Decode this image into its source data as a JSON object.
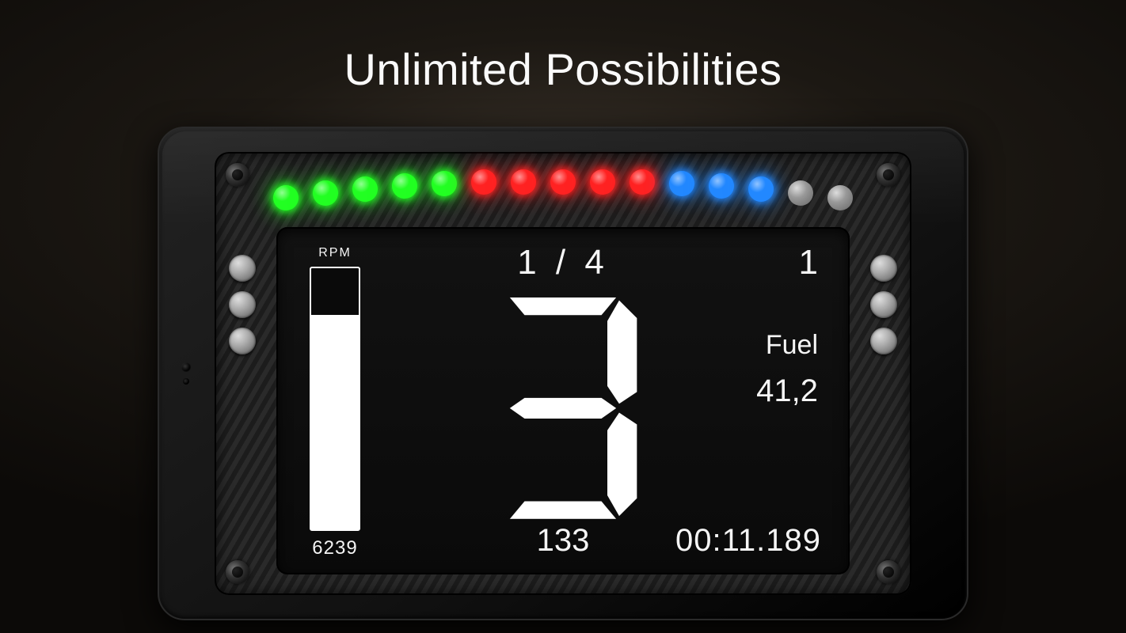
{
  "title": "Unlimited Possibilities",
  "leds": [
    {
      "color": "#22ff22",
      "on": true
    },
    {
      "color": "#22ff22",
      "on": true
    },
    {
      "color": "#22ff22",
      "on": true
    },
    {
      "color": "#22ff22",
      "on": true
    },
    {
      "color": "#22ff22",
      "on": true
    },
    {
      "color": "#ff2222",
      "on": true
    },
    {
      "color": "#ff2222",
      "on": true
    },
    {
      "color": "#ff2222",
      "on": true
    },
    {
      "color": "#ff2222",
      "on": true
    },
    {
      "color": "#ff2222",
      "on": true
    },
    {
      "color": "#2288ff",
      "on": true
    },
    {
      "color": "#2288ff",
      "on": true
    },
    {
      "color": "#2288ff",
      "on": true
    },
    {
      "color": "#dddddd",
      "on": false
    },
    {
      "color": "#dddddd",
      "on": false
    }
  ],
  "rpm": {
    "label": "RPM",
    "value": "6239",
    "fill_pct": 82
  },
  "lap_pos": "1 / 4",
  "position": "1",
  "gear": "3",
  "fuel": {
    "label": "Fuel",
    "value": "41,2"
  },
  "speed": "133",
  "laptime": "00:11.189"
}
